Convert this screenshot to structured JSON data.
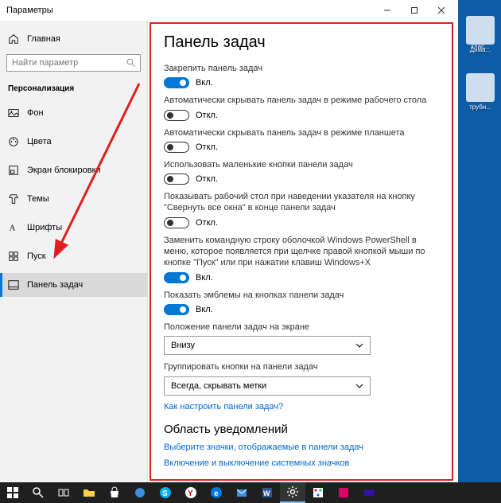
{
  "window": {
    "title": "Параметры"
  },
  "sidebar": {
    "home": "Главная",
    "search_placeholder": "Найти параметр",
    "category": "Персонализация",
    "items": [
      {
        "label": "Фон"
      },
      {
        "label": "Цвета"
      },
      {
        "label": "Экран блокировки"
      },
      {
        "label": "Темы"
      },
      {
        "label": "Шрифты"
      },
      {
        "label": "Пуск"
      },
      {
        "label": "Панель задач"
      }
    ]
  },
  "page": {
    "title": "Панель задач",
    "settings": [
      {
        "label": "Закрепить панель задач",
        "state_label": "Вкл.",
        "on": true
      },
      {
        "label": "Автоматически скрывать панель задач в режиме рабочего стола",
        "state_label": "Откл.",
        "on": false
      },
      {
        "label": "Автоматически скрывать панель задач в режиме планшета",
        "state_label": "Откл.",
        "on": false
      },
      {
        "label": "Использовать маленькие кнопки панели задач",
        "state_label": "Откл.",
        "on": false
      },
      {
        "label": "Показывать рабочий стол при наведении указателя на кнопку \"Свернуть все окна\" в конце панели задач",
        "state_label": "Откл.",
        "on": false
      },
      {
        "label": "Заменить командную строку оболочкой Windows PowerShell в меню, которое появляется при щелчке правой кнопкой мыши по кнопке \"Пуск\" или при нажатии клавиш Windows+X",
        "state_label": "Вкл.",
        "on": true
      },
      {
        "label": "Показать эмблемы на кнопках панели задач",
        "state_label": "Вкл.",
        "on": true
      }
    ],
    "dropdowns": [
      {
        "label": "Положение панели задач на экране",
        "value": "Внизу"
      },
      {
        "label": "Группировать кнопки на панели задач",
        "value": "Всегда, скрывать метки"
      }
    ],
    "links": {
      "howto": "Как настроить панели задач?"
    },
    "notification_section": {
      "title": "Область уведомлений",
      "link1": "Выберите значки, отображаемые в панели задач",
      "link2": "Включение и выключение системных значков"
    }
  },
  "desktop": {
    "icons": [
      {
        "label": "Дима..."
      },
      {
        "label": "клас..."
      },
      {
        "label": "трубн..."
      }
    ]
  }
}
